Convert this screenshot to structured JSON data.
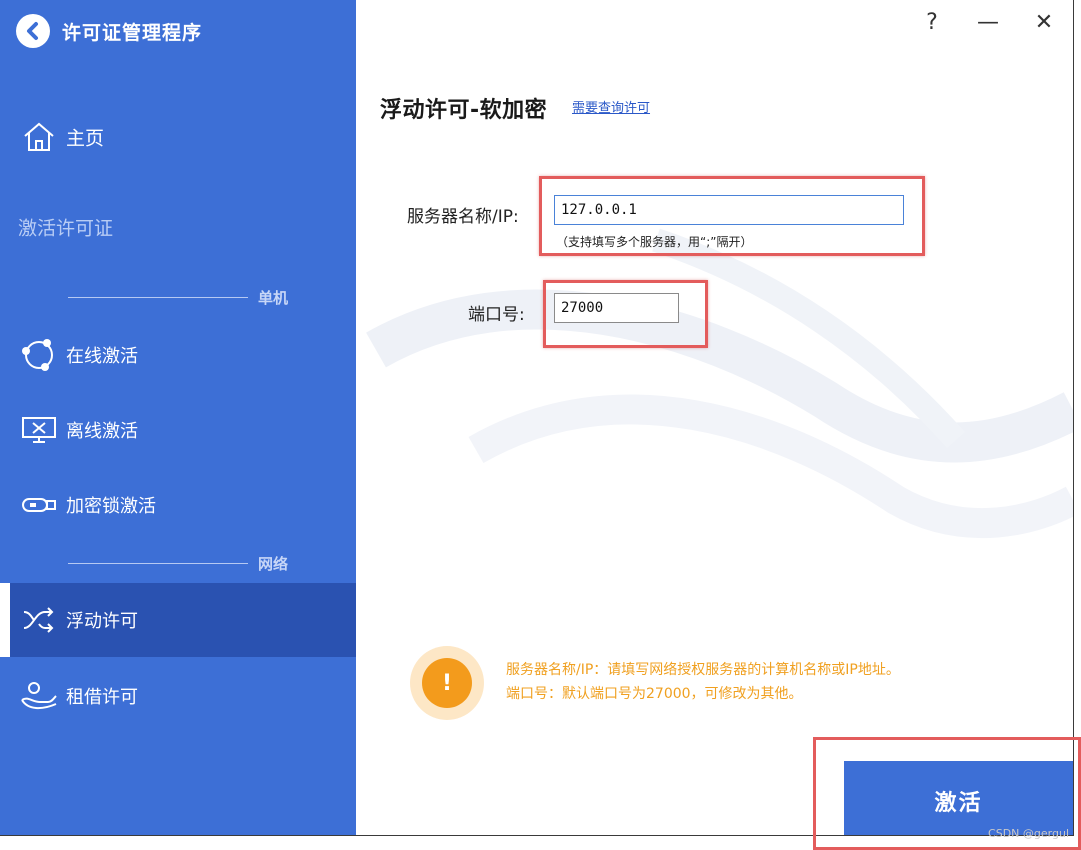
{
  "app": {
    "title": "许可证管理程序"
  },
  "sidebar": {
    "home": "主页",
    "activate_heading": "激活许可证",
    "section_single": "单机",
    "section_network": "网络",
    "items": [
      {
        "label": "在线激活",
        "icon": "online-network-icon"
      },
      {
        "label": "离线激活",
        "icon": "monitor-icon"
      },
      {
        "label": "加密锁激活",
        "icon": "usb-dongle-icon"
      },
      {
        "label": "浮动许可",
        "icon": "shuffle-icon",
        "selected": true
      },
      {
        "label": "租借许可",
        "icon": "hand-user-icon"
      }
    ]
  },
  "window_controls": {
    "help": "?",
    "minimize": "—",
    "close": "✕"
  },
  "main": {
    "heading": "浮动许可-软加密",
    "heading_link": "需要查询许可",
    "server_label": "服务器名称/IP:",
    "server_value": "127.0.0.1",
    "server_hint": "（支持填写多个服务器，用“;”隔开）",
    "port_label": "端口号:",
    "port_value": "27000",
    "info_line1": "服务器名称/IP：请填写网络授权服务器的计算机名称或IP地址。",
    "info_line2": "端口号：默认端口号为27000，可修改为其他。",
    "info_icon_glyph": "!",
    "activate_button": "激活"
  },
  "watermark": "CSDN @gergul",
  "colors": {
    "sidebar": "#3d6fd6",
    "selected": "#2a52b1",
    "accent_orange": "#f39b1c",
    "highlight_red": "#e35c5c"
  }
}
